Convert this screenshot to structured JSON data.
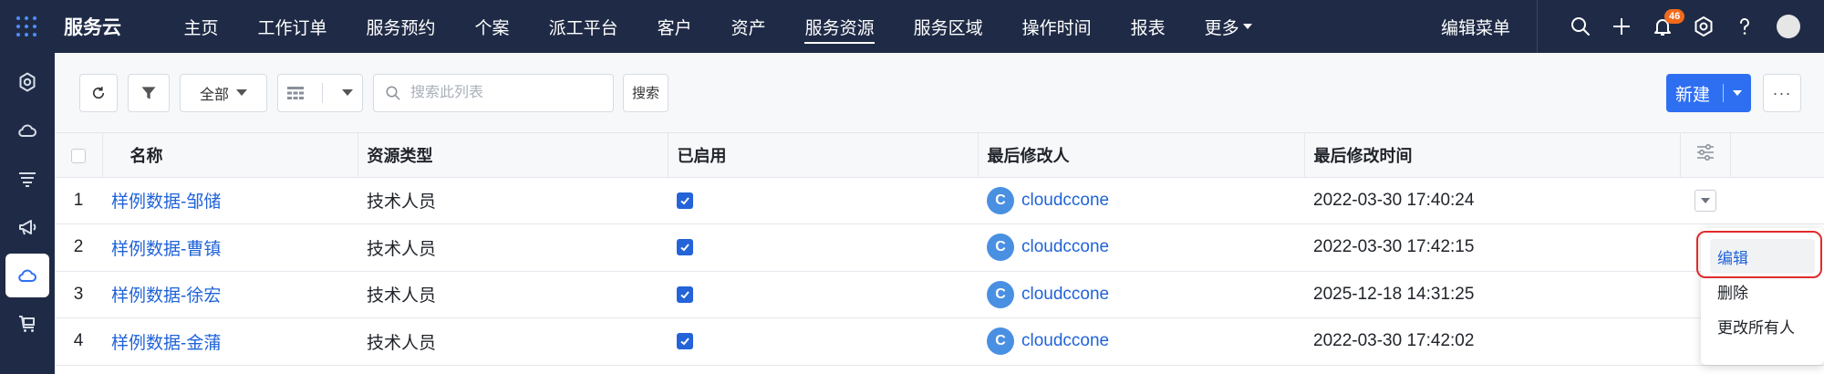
{
  "topnav": {
    "app_name": "服务云",
    "items": [
      {
        "label": "主页"
      },
      {
        "label": "工作订单"
      },
      {
        "label": "服务预约"
      },
      {
        "label": "个案"
      },
      {
        "label": "派工平台"
      },
      {
        "label": "客户"
      },
      {
        "label": "资产"
      },
      {
        "label": "服务资源",
        "active": true
      },
      {
        "label": "服务区域"
      },
      {
        "label": "操作时间"
      },
      {
        "label": "报表"
      },
      {
        "label": "更多"
      }
    ],
    "edit_menu": "编辑菜单",
    "notification_count": "46",
    "icons": [
      "search-icon",
      "plus-icon",
      "bell-icon",
      "settings-icon",
      "help-icon",
      "avatar"
    ]
  },
  "sidebar": {
    "items": [
      "gear-icon",
      "cloud-icon",
      "filter-list-icon",
      "megaphone-icon",
      "cloud-icon",
      "cart-icon"
    ],
    "active_index": 4
  },
  "toolbar": {
    "scope_label": "全部",
    "search_placeholder": "搜索此列表",
    "search_button": "搜索",
    "new_button": "新建",
    "more_button": "···"
  },
  "table": {
    "columns": [
      "名称",
      "资源类型",
      "已启用",
      "最后修改人",
      "最后修改时间"
    ],
    "rows": [
      {
        "index": "1",
        "name": "样例数据-邹储",
        "type": "技术人员",
        "enabled": true,
        "modifier": "cloudccone",
        "modifier_initial": "C",
        "time": "2022-03-30 17:40:24"
      },
      {
        "index": "2",
        "name": "样例数据-曹镇",
        "type": "技术人员",
        "enabled": true,
        "modifier": "cloudccone",
        "modifier_initial": "C",
        "time": "2022-03-30 17:42:15"
      },
      {
        "index": "3",
        "name": "样例数据-徐宏",
        "type": "技术人员",
        "enabled": true,
        "modifier": "cloudccone",
        "modifier_initial": "C",
        "time": "2025-12-18 14:31:25"
      },
      {
        "index": "4",
        "name": "样例数据-金蒲",
        "type": "技术人员",
        "enabled": true,
        "modifier": "cloudccone",
        "modifier_initial": "C",
        "time": "2022-03-30 17:42:02"
      }
    ]
  },
  "row_menu": {
    "items": [
      "编辑",
      "删除",
      "更改所有人"
    ],
    "active_index": 0
  },
  "colors": {
    "nav_bg": "#1f2b46",
    "accent": "#2e6ff2",
    "link": "#1f63d8",
    "badge": "#f26a1b",
    "highlight": "#e02b2b"
  }
}
